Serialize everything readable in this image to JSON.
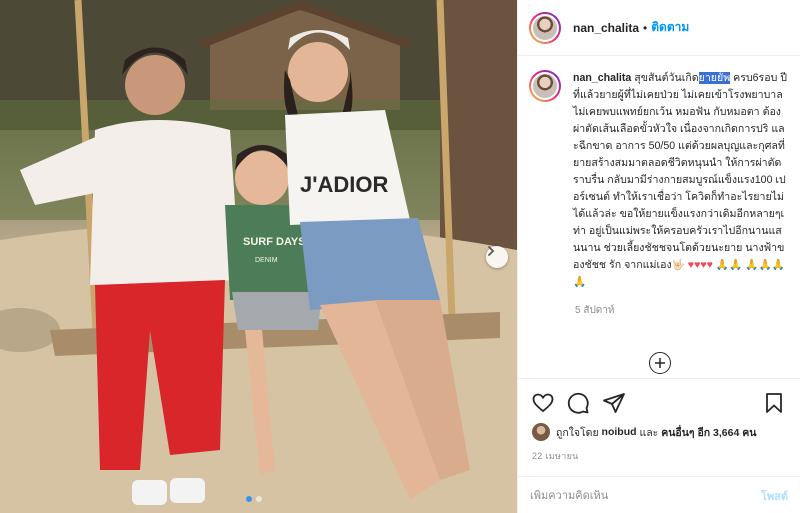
{
  "photo": {
    "shirt_text": "J'ADIOR",
    "kid_shirt_text": "SURF DAYS",
    "kid_shirt_small": "DENIM"
  },
  "header": {
    "username": "nan_chalita",
    "separator": "•",
    "follow_label": "ติดตาม"
  },
  "caption": {
    "username": "nan_chalita",
    "text_before": "สุขสันต์วันเกิด",
    "highlight": "ยายยัพ",
    "text_after": " ครบ6รอบ ปีที่แล้วยายผู้ที่ไม่เคยป่วย ไม่เคยเข้าโรงพยาบาล ไม่เคยพบแพทย์ยกเว้น หมอฟัน กับหมอตา ต้องผ่าตัดเส้นเลือดขั้วหัวใจ เนื่องจากเกิดการปริ และฉีกขาด อาการ 50/50 แต่ด้วยผลบุญและกุศลที่ยายสร้างสมมาตลอดชีวิตหนุนนำ ให้การผ่าตัดราบรื่น กลับมามีร่างกายสมบูรณ์แข็งแรง100 เปอร์เซนต์ ทำให้เราเชื่อว่า โควิดก็ทำอะไรยายไม่ได้แล้วล่ะ ขอให้ยายแข็งแรงกว่าเดิมอีกหลายๆเท่า อยู่เป็นแม่พระให้ครอบครัวเราไปอีกนานแสนนาน ช่วยเลี้ยงชัชชจนโตด้วยนะยาย นางฟ้าของชัชช รัก จากแม่เอง",
    "emojis": "🤟🏻",
    "hearts": "♥♥♥♥",
    "hands_a": "🙏🙏",
    "hands_b": "🙏🙏🙏🙏",
    "time_ago": "5 สัปดาห์"
  },
  "likes": {
    "prefix": "ถูกใจโดย",
    "user": "noibud",
    "middle": "และ",
    "others": "คนอื่นๆ อีก 3,664 คน"
  },
  "date": "22 เมษายน",
  "comment_box": {
    "placeholder": "เพิ่มความคิดเห็น",
    "post_label": "โพสต์"
  },
  "colors": {
    "follow_blue": "#0095f6",
    "heart_red": "#ed4956",
    "highlight_blue": "#3b6fd6",
    "post_disabled": "#b2dffc"
  },
  "icons": [
    "heart-icon",
    "comment-icon",
    "share-icon",
    "bookmark-icon",
    "plus-circle-icon",
    "chevron-right-icon"
  ]
}
